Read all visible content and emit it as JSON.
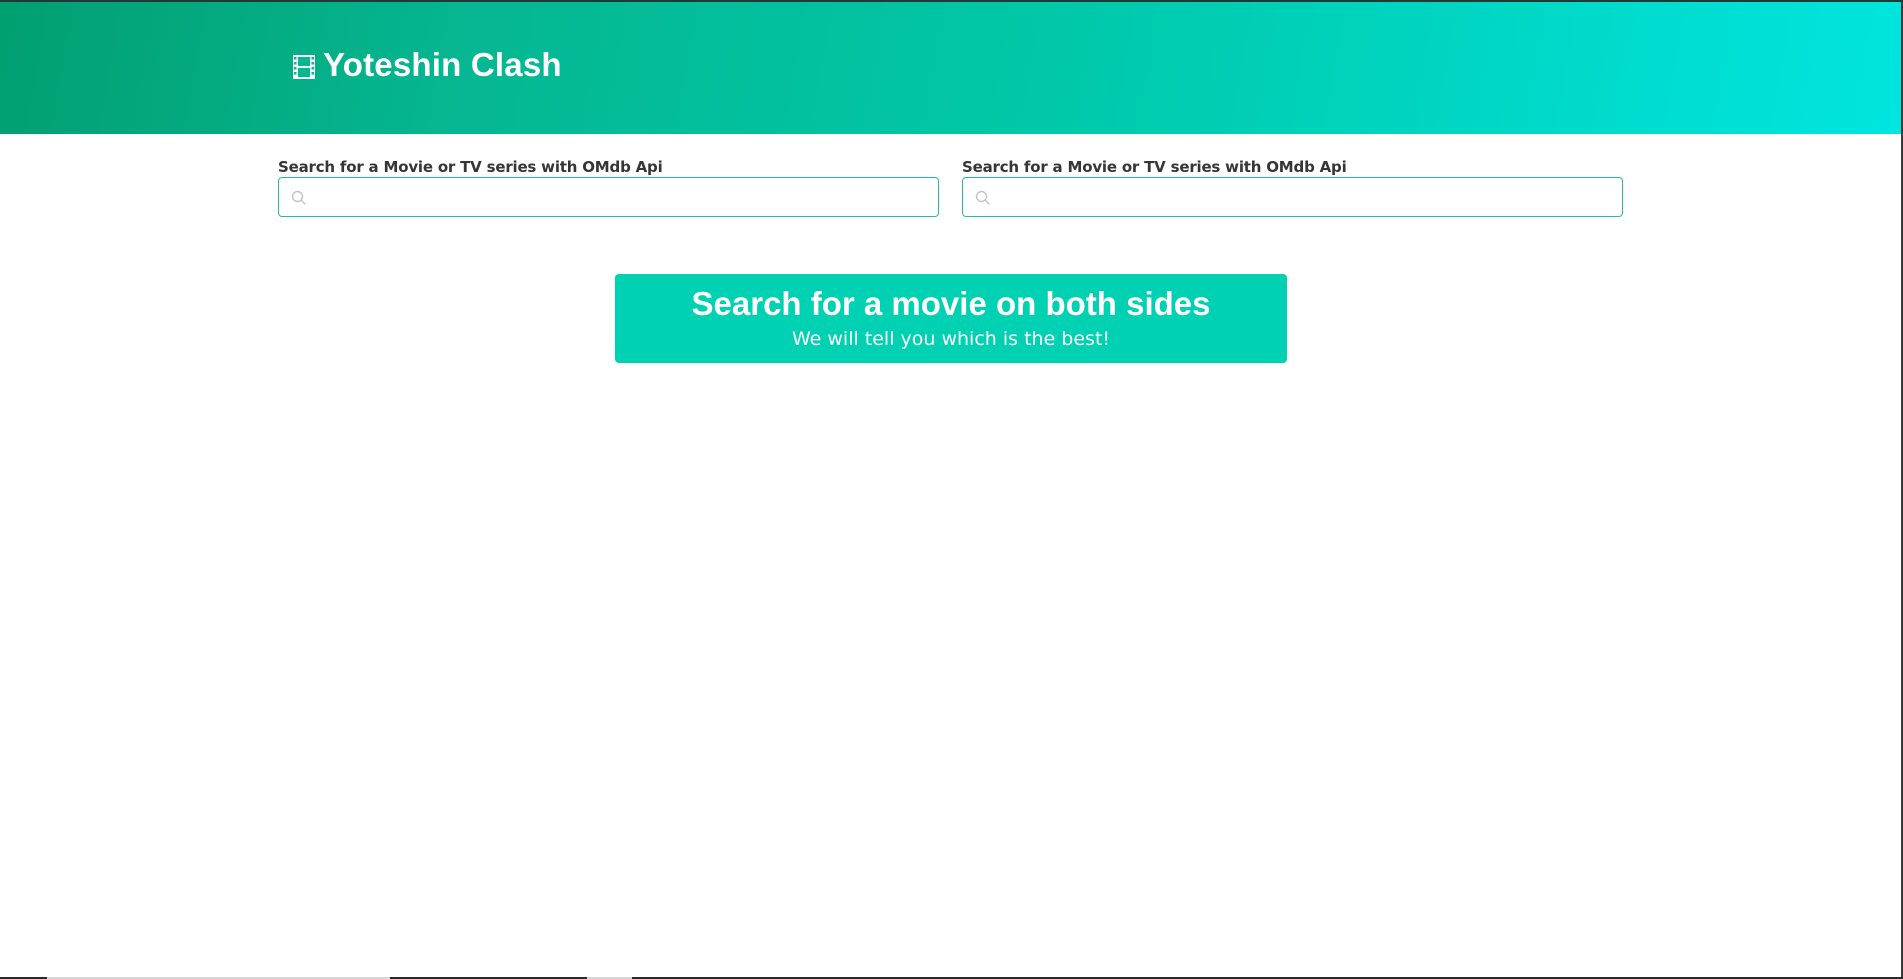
{
  "header": {
    "logo_icon": "film-icon",
    "title": "Yoteshin Clash",
    "gradient_start": "#029f70",
    "gradient_end": "#00e5e0"
  },
  "search": {
    "left": {
      "label": "Search for a Movie or TV series with OMdb Api",
      "value": "",
      "icon": "search-icon"
    },
    "right": {
      "label": "Search for a Movie or TV series with OMdb Api",
      "value": "",
      "icon": "search-icon"
    }
  },
  "notification": {
    "title": "Search for a movie on both sides",
    "subtitle": "We will tell you which is the best!",
    "color": "#00d1b2"
  }
}
